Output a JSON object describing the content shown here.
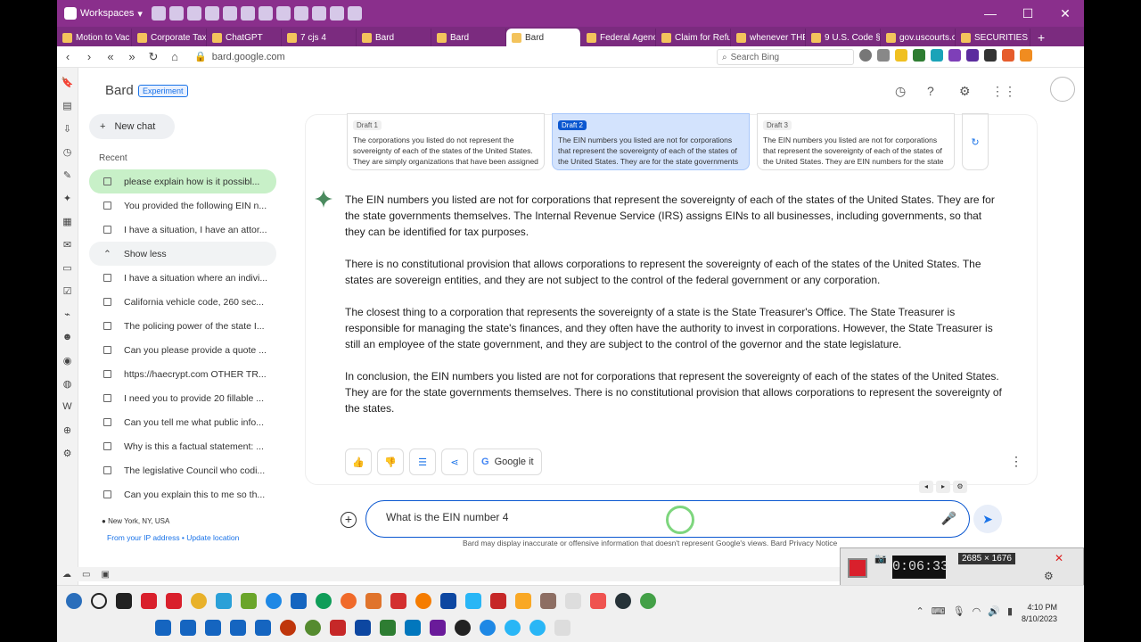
{
  "browser": {
    "workspaces_label": "Workspaces",
    "tabs": [
      "Motion to Vac",
      "Corporate Tax",
      "ChatGPT",
      "7 cjs 4",
      "Bard",
      "Bard",
      "Bard",
      "Federal Agenc",
      "Claim for Refu",
      "whenever THE",
      "9 U.S. Code §",
      "gov.uscourts.c",
      "SECURITIES A"
    ],
    "active_tab_index": 6,
    "url": "bard.google.com",
    "search_placeholder": "Search Bing"
  },
  "bard": {
    "title": "Bard",
    "badge": "Experiment"
  },
  "sidebar": {
    "new_chat": "New chat",
    "recent_label": "Recent",
    "chats": [
      "please explain how is it possibl...",
      "You provided the following EIN n...",
      "I have a situation, I have an attor...",
      "Show less",
      "I have a situation where an indivi...",
      "California vehicle code, 260 sec...",
      "The policing power of the state I...",
      "Can you please provide a quote ...",
      "https://haecrypt.com OTHER TR...",
      "I need you to provide 20 fillable ...",
      "Can you tell me what public info...",
      "Why is this a factual statement: ...",
      "The legislative Council who codi...",
      "Can you explain this to me so th..."
    ],
    "location": "New York, NY, USA",
    "location_link": "From your IP address • Update location"
  },
  "drafts": [
    {
      "label": "Draft 1",
      "text": "The corporations you listed do not represent the sovereignty of each of the states of the United States. They are simply organizations that have been assigned Employer"
    },
    {
      "label": "Draft 2",
      "text": "The EIN numbers you listed are not for corporations that represent the sovereignty of each of the states of the United States. They are for the state governments themselves."
    },
    {
      "label": "Draft 3",
      "text": "The EIN numbers you listed are not for corporations that represent the sovereignty of each of the states of the United States. They are EIN numbers for the state governments"
    }
  ],
  "response": {
    "paragraphs": [
      "The EIN numbers you listed are not for corporations that represent the sovereignty of each of the states of the United States. They are for the state governments themselves. The Internal Revenue Service (IRS) assigns EINs to all businesses, including governments, so that they can be identified for tax purposes.",
      "There is no constitutional provision that allows corporations to represent the sovereignty of each of the states of the United States. The states are sovereign entities, and they are not subject to the control of the federal government or any corporation.",
      "The closest thing to a corporation that represents the sovereignty of a state is the State Treasurer's Office. The State Treasurer is responsible for managing the state's finances, and they often have the authority to invest in corporations. However, the State Treasurer is still an employee of the state government, and they are subject to the control of the governor and the state legislature.",
      "In conclusion, the EIN numbers you listed are not for corporations that represent the sovereignty of each of the states of the United States. They are for the state governments themselves. There is no constitutional provision that allows corporations to represent the sovereignty of the states."
    ],
    "google_it": "Google it"
  },
  "input": {
    "value": "What is the EIN number 4"
  },
  "disclaimer": "Bard may display inaccurate or offensive information that doesn't represent Google's views. Bard Privacy Notice",
  "recorder": {
    "time": "0:06:33",
    "resolution": "2685 × 1676"
  },
  "taskbar": {
    "time": "4:10 PM",
    "date": "8/10/2023"
  }
}
